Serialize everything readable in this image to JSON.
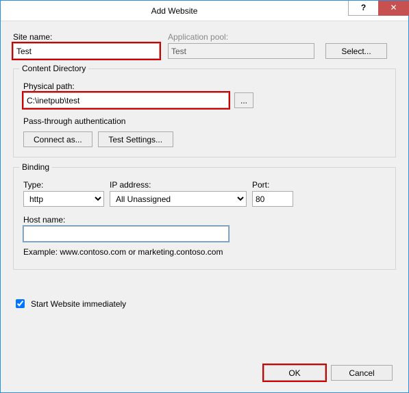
{
  "titlebar": {
    "title": "Add Website",
    "help": "?",
    "close": "✕"
  },
  "site_name": {
    "label": "Site name:",
    "value": "Test"
  },
  "app_pool": {
    "label": "Application pool:",
    "value": "Test",
    "select_btn": "Select..."
  },
  "content_dir": {
    "title": "Content Directory",
    "path_label": "Physical path:",
    "path_value": "C:\\inetpub\\test",
    "browse": "...",
    "passthru": "Pass-through authentication",
    "connect_as": "Connect as...",
    "test_settings": "Test Settings..."
  },
  "binding": {
    "title": "Binding",
    "type_label": "Type:",
    "type_value": "http",
    "ip_label": "IP address:",
    "ip_value": "All Unassigned",
    "port_label": "Port:",
    "port_value": "80",
    "host_label": "Host name:",
    "host_value": "",
    "example": "Example: www.contoso.com or marketing.contoso.com"
  },
  "start_checkbox": {
    "label": "Start Website immediately"
  },
  "buttons": {
    "ok": "OK",
    "cancel": "Cancel"
  }
}
